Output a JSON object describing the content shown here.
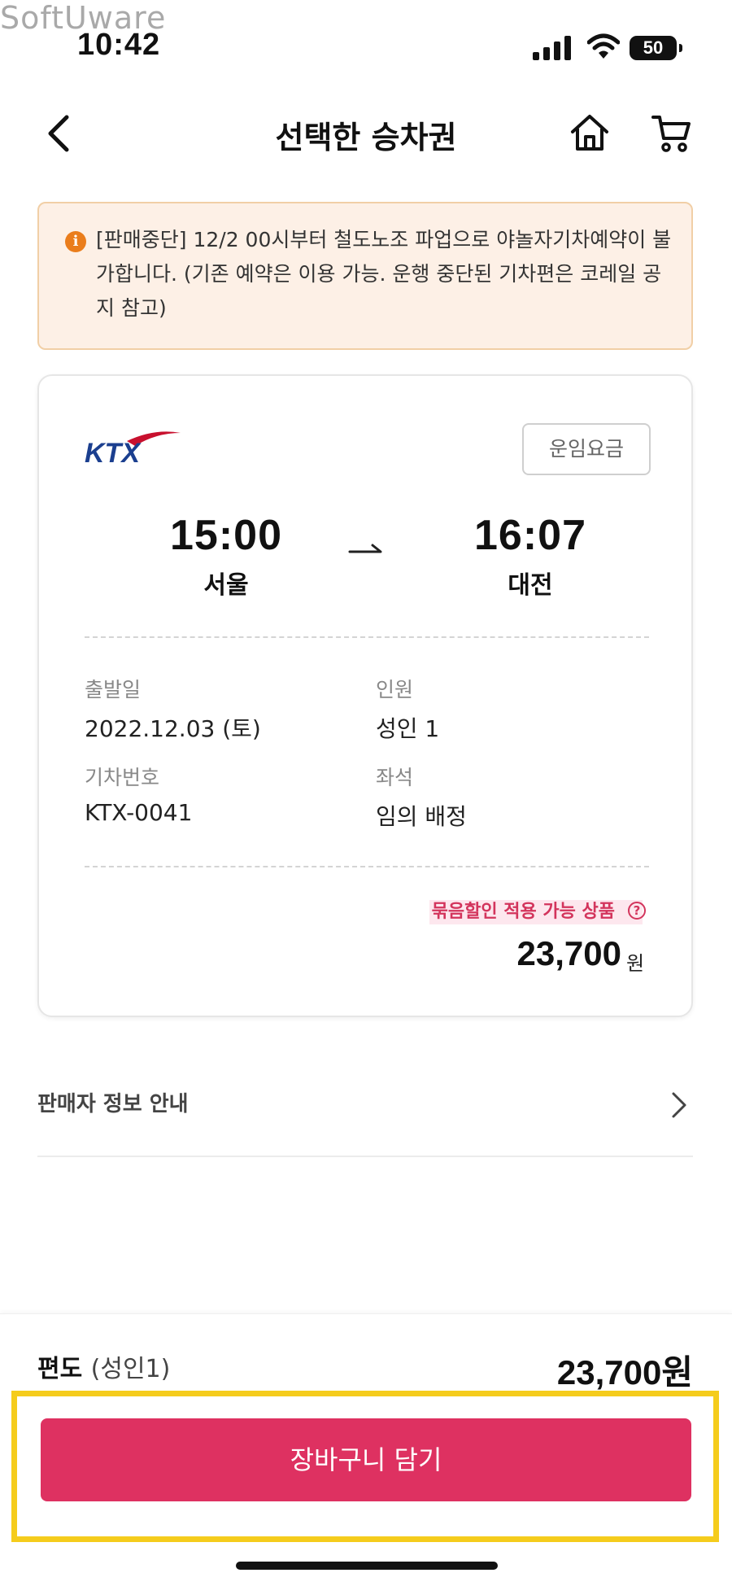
{
  "watermark": "SoftUware",
  "status_bar": {
    "time": "10:42",
    "battery": "50"
  },
  "header": {
    "title": "선택한 승차권"
  },
  "notice": {
    "text": "[판매중단] 12/2 00시부터 철도노조 파업으로 야놀자기차예약이 불가합니다. (기존 예약은 이용 가능. 운행 중단된 기차편은 코레일 공지 참고)"
  },
  "ticket": {
    "brand": "KTX",
    "fare_button": "운임요금",
    "departure": {
      "time": "15:00",
      "station": "서울"
    },
    "arrival": {
      "time": "16:07",
      "station": "대전"
    },
    "details": {
      "date_label": "출발일",
      "date_value": "2022.12.03 (토)",
      "passengers_label": "인원",
      "passengers_value": "성인 1",
      "train_label": "기차번호",
      "train_value": "KTX-0041",
      "seat_label": "좌석",
      "seat_value": "임의 배정"
    },
    "bundle_discount": "묶음할인 적용 가능 상품",
    "price": "23,700",
    "price_unit": "원"
  },
  "seller_info": {
    "label": "판매자 정보 안내"
  },
  "bottom_bar": {
    "trip_type": "편도",
    "trip_passengers": "(성인1)",
    "total": "23,700원",
    "add_to_cart": "장바구니 담기"
  },
  "colors": {
    "accent": "#de3161",
    "notice_bg": "#fdf0e6",
    "notice_icon": "#ea7d1c",
    "highlight": "#f5cc1c",
    "ktx_blue": "#1b3f8f",
    "ktx_red": "#c8102e"
  }
}
